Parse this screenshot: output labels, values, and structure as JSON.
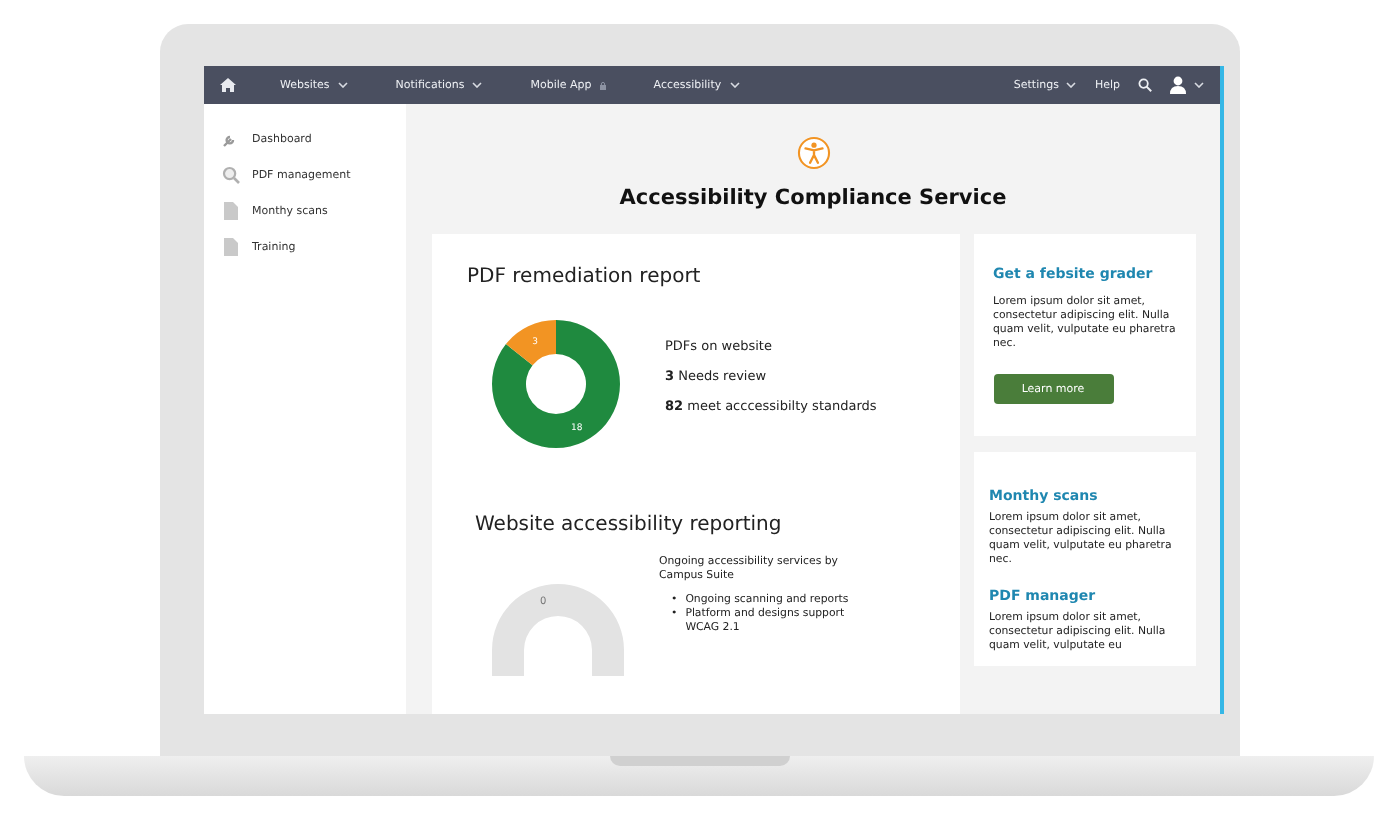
{
  "navbar": {
    "left_items": [
      {
        "label": "Websites",
        "kind": "dropdown"
      },
      {
        "label": "Notifications",
        "kind": "dropdown"
      },
      {
        "label": "Mobile App",
        "kind": "locked"
      },
      {
        "label": "Accessibility",
        "kind": "dropdown"
      }
    ],
    "right_items": [
      {
        "label": "Settings",
        "kind": "dropdown"
      },
      {
        "label": "Help",
        "kind": "plain"
      }
    ]
  },
  "sidebar": {
    "items": [
      {
        "label": "Dashboard",
        "kind": "wrench"
      },
      {
        "label": "PDF management",
        "kind": "search-doc"
      },
      {
        "label": "Monthy scans",
        "kind": "doc"
      },
      {
        "label": "Training",
        "kind": "doc"
      }
    ]
  },
  "page_title": "Accessibility Compliance Service",
  "pdf_report": {
    "title": "PDF remediation report",
    "chart_data": {
      "type": "donut",
      "values": [
        18,
        3
      ],
      "data_labels": true
    },
    "stats_heading": "PDFs on website",
    "stats": [
      {
        "count": "3",
        "text": "Needs review"
      },
      {
        "count": "82",
        "text": "meet acccessibilty standards"
      }
    ]
  },
  "web_report": {
    "title": "Website accessibility reporting",
    "chart_label": "0",
    "intro": "Ongoing accessibility services by Campus Suite",
    "bullets": [
      {
        "marker": "•",
        "text": "Ongoing scanning and reports"
      },
      {
        "marker": "•",
        "text": "Platform and designs support WCAG 2.1"
      }
    ]
  },
  "promo": {
    "title": "Get a febsite grader",
    "text": "Lorem ipsum dolor sit amet, consectetur adipiscing elit. Nulla quam velit, vulputate eu pharetra nec.",
    "button": "Learn more"
  },
  "links": [
    {
      "title": "Monthy scans",
      "text": "Lorem ipsum dolor sit amet, consectetur adipiscing elit. Nulla quam velit, vulputate eu pharetra nec."
    },
    {
      "title": "PDF manager",
      "text": "Lorem ipsum dolor sit amet, consectetur adipiscing elit. Nulla quam velit, vulputate eu"
    }
  ]
}
